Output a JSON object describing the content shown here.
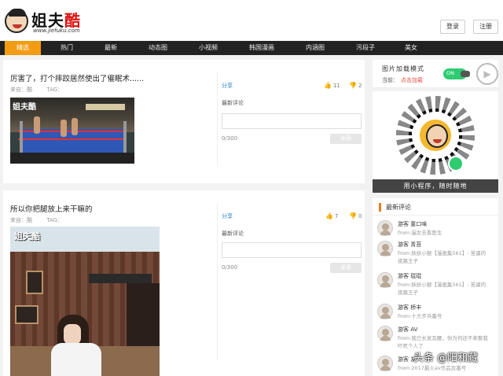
{
  "header": {
    "logo_text_a": "姐夫",
    "logo_text_b": "酷",
    "logo_url": "www.jiefuku.com",
    "login_label": "登录",
    "register_label": "注册"
  },
  "nav": {
    "items": [
      "精选",
      "热门",
      "最新",
      "动态图",
      "小视频",
      "韩国漫画",
      "内涵图",
      "污段子",
      "美女"
    ],
    "active_index": 0
  },
  "posts": [
    {
      "title": "厉害了，打个摔跤居然使出了催眠术......",
      "source": "来自：酷",
      "tag": "TAG：",
      "share": "分享",
      "likes": "11",
      "dislikes": "2",
      "comments_label": "最新评论",
      "char_count": "0/300",
      "submit_label": "发表",
      "image_logo": "姐夫酷"
    },
    {
      "title": "所以你把腿放上来干嘛的",
      "source": "来自：酷",
      "tag": "TAG：",
      "share": "分享",
      "likes": "7",
      "dislikes": "0",
      "comments_label": "最新评论",
      "char_count": "0/300",
      "submit_label": "发表",
      "image_logo": "姐夫酷"
    }
  ],
  "sidebar": {
    "mode_title": "图片加载模式",
    "mode_current_label": "当前：",
    "mode_current_value": "点击加载",
    "toggle_label": "ON",
    "qr_banner": "用小程序，随时随地",
    "latest_comments_title": "最新评论",
    "comments": [
      {
        "name": "游客 童口味",
        "from": "from:漏女去看医生"
      },
      {
        "name": "游客 青苔",
        "from": "from:妖妖小额【漫画集561】- 苦逼的夜路王子"
      },
      {
        "name": "游客 琨琨",
        "from": "from:妖妖小额【漫画集561】- 苦逼的夜路王子"
      },
      {
        "name": "游客 桥丰",
        "from": "from:十大步兵番号"
      },
      {
        "name": "游客 AV",
        "from": "from:我已长发及腰，你为何还不来娶我吓死个人了"
      },
      {
        "name": "游客 友",
        "from": "from:2017最火av作品及番号"
      }
    ]
  },
  "watermark": "头条 @阳和藏",
  "colors": {
    "nav_bg": "#222222",
    "nav_active": "#f39c12",
    "link_blue": "#2a80c8",
    "toggle_green": "#2ecc71"
  }
}
